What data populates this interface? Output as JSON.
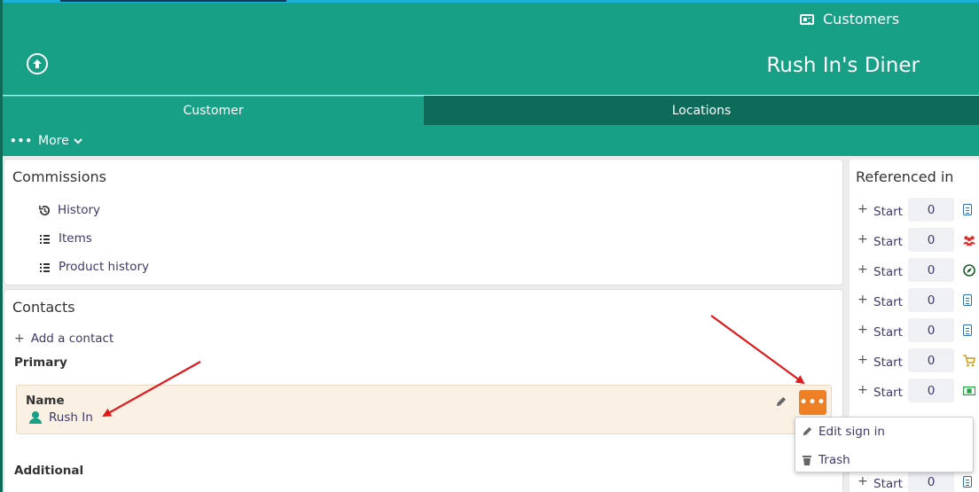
{
  "header": {
    "module_name": "Customers",
    "record_title": "Rush In's Diner"
  },
  "tabs": [
    {
      "label": "Customer"
    },
    {
      "label": "Locations"
    }
  ],
  "more_button": {
    "label": "More"
  },
  "commissions": {
    "title": "Commissions",
    "links": [
      {
        "label": "History",
        "icon": "history-icon"
      },
      {
        "label": "Items",
        "icon": "list-icon"
      },
      {
        "label": "Product history",
        "icon": "list-icon"
      }
    ]
  },
  "contacts": {
    "title": "Contacts",
    "add_label": "Add a contact",
    "primary_label": "Primary",
    "card": {
      "field_label": "Name",
      "value": "Rush In"
    },
    "additional_label": "Additional"
  },
  "contact_menu": {
    "items": [
      {
        "label": "Edit sign in",
        "icon": "pencil-icon"
      },
      {
        "label": "Trash",
        "icon": "trash-icon"
      }
    ]
  },
  "referenced_in": {
    "title": "Referenced in",
    "rows": [
      {
        "action": "Start",
        "count": "0",
        "icon": "document-icon",
        "color": "#2c6fb0"
      },
      {
        "action": "Start",
        "count": "0",
        "icon": "group-icon",
        "color": "#d9302b"
      },
      {
        "action": "Start",
        "count": "0",
        "icon": "compass-icon",
        "color": "#1a5d2a"
      },
      {
        "action": "Start",
        "count": "0",
        "icon": "document-icon",
        "color": "#2c6fb0"
      },
      {
        "action": "Start",
        "count": "0",
        "icon": "document-icon",
        "color": "#2c6fb0"
      },
      {
        "action": "Start",
        "count": "0",
        "icon": "cart-icon",
        "color": "#c9a21e"
      },
      {
        "action": "Start",
        "count": "0",
        "icon": "money-icon",
        "color": "#2aa34a"
      },
      {
        "action": "Start",
        "count": "0",
        "icon": "document-icon",
        "color": "#2c6fb0"
      }
    ]
  },
  "colors": {
    "brand": "#17a085",
    "brand_dark": "#0e6b5a",
    "accent": "#ee7f25",
    "annotation_arrow": "#e01a1a"
  }
}
